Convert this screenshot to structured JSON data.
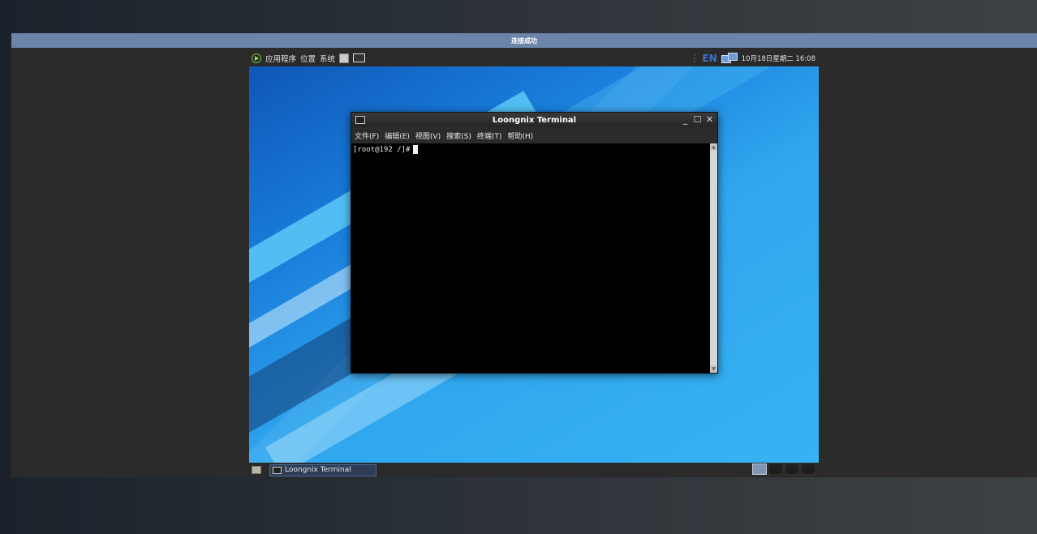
{
  "vnc": {
    "status_text": "连接成功"
  },
  "top_panel": {
    "menus": [
      "应用程序",
      "位置",
      "系统"
    ],
    "input_method": "EN",
    "clock": "10月18日星期二 16:08"
  },
  "terminal": {
    "title": "Loongnix Terminal",
    "menu": [
      "文件(F)",
      "编辑(E)",
      "视图(V)",
      "搜索(S)",
      "终端(T)",
      "帮助(H)"
    ],
    "prompt": "[root@192 /]#"
  },
  "taskbar": {
    "items": [
      {
        "label": "Loongnix Terminal"
      }
    ]
  }
}
